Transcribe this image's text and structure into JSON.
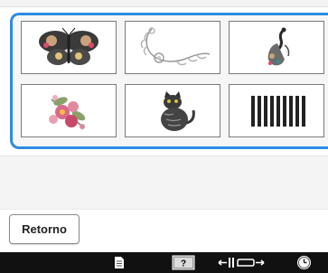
{
  "screen": {
    "accent_color": "#2d8be2",
    "background_color": "#ffffff",
    "panel_background": "#f6f6f6",
    "status_bar_color": "#111111"
  },
  "patterns": [
    {
      "icon": "butterfly-pattern-icon",
      "selected": false
    },
    {
      "icon": "floral-vine-corner-pattern-icon",
      "selected": false
    },
    {
      "icon": "peacock-pattern-icon",
      "selected": false
    },
    {
      "icon": "flower-bouquet-pattern-icon",
      "selected": false
    },
    {
      "icon": "cat-pattern-icon",
      "selected": false
    },
    {
      "icon": "color-stripes-pattern-icon",
      "selected": false
    }
  ],
  "buttons": {
    "back_label": "Retorno"
  },
  "status_bar": {
    "icons": [
      "document-icon",
      "help-icon",
      "presser-foot-width-icon",
      "clock-icon"
    ],
    "help_icon_text": "?"
  }
}
